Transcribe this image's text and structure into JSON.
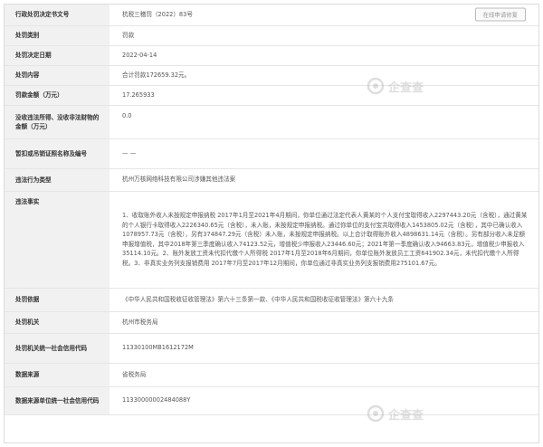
{
  "header_button": "在线申请修复",
  "rows": [
    {
      "label": "行政处罚决定书文号",
      "value": "杭税三稽罚（2022）83号"
    },
    {
      "label": "处罚类别",
      "value": "罚款"
    },
    {
      "label": "处罚决定日期",
      "value": "2022-04-14"
    },
    {
      "label": "处罚内容",
      "value": "合计罚款172659.32元。"
    },
    {
      "label": "罚款金额（万元）",
      "value": "17.265933"
    },
    {
      "label": "没收违法所得、没收非法财物的金额（万元）",
      "value": "0.0"
    },
    {
      "label": "暂扣或吊销证照名称及编号",
      "value": "— —"
    },
    {
      "label": "违法行为类型",
      "value": "杭州万核网络科技有限公司涉嫌其他违法案"
    },
    {
      "label": "违法事实",
      "value": "1、收取账外收入未按规定申报纳税 2017年1月至2021年4月期间，你单位通过法定代表人黄某的个人支付宝取得收入2297443.20元（含税），通过黄某的个人银行卡取得收入2226340.65元（含税），未入账，未按规定申报纳税。通过你单位的支付宝共取得收入1453805.02元（含税），其中已确认收入1078957.73元（含税），另有374847.29元（含税）未入账，未按规定申报纳税。以上合计取得账外收入4898631.14元（含税）。另有部分收入未足额申报增值税，其中2018年第三季度确认收入74123.52元，增值税少申报收入23446.60元；2021年第一季度确认收入94663.83元，增值税少申报收入35114.10元。2、账外发放工资未代扣代缴个人所得税 2017年1月至2018年6月期间，你单位账外发放员工工资641902.34元，未代扣代缴个人所得税。3、非真实业务列支报销费用 2017年7月至2017年12月期间，你单位通过非真实业务列支报销费用275101.67元。"
    },
    {
      "label": "处罚依据",
      "value": "《中华人民共和国税收征收管理法》第六十三条第一款、《中华人民共和国税收征收管理法》第六十九条"
    },
    {
      "label": "处罚机关",
      "value": "杭州市税务局"
    },
    {
      "label": "处罚机关统一社会信用代码",
      "value": "11330100MB1612172M"
    },
    {
      "label": "数据来源",
      "value": "省税务局"
    },
    {
      "label": "数据来源单位统一社会信用代码",
      "value": "11330000002484088Y"
    }
  ],
  "watermark_text": "企查查",
  "colors": {
    "label_bg": "#f1f1f1",
    "border": "#e6e6e6",
    "text": "#555555"
  }
}
